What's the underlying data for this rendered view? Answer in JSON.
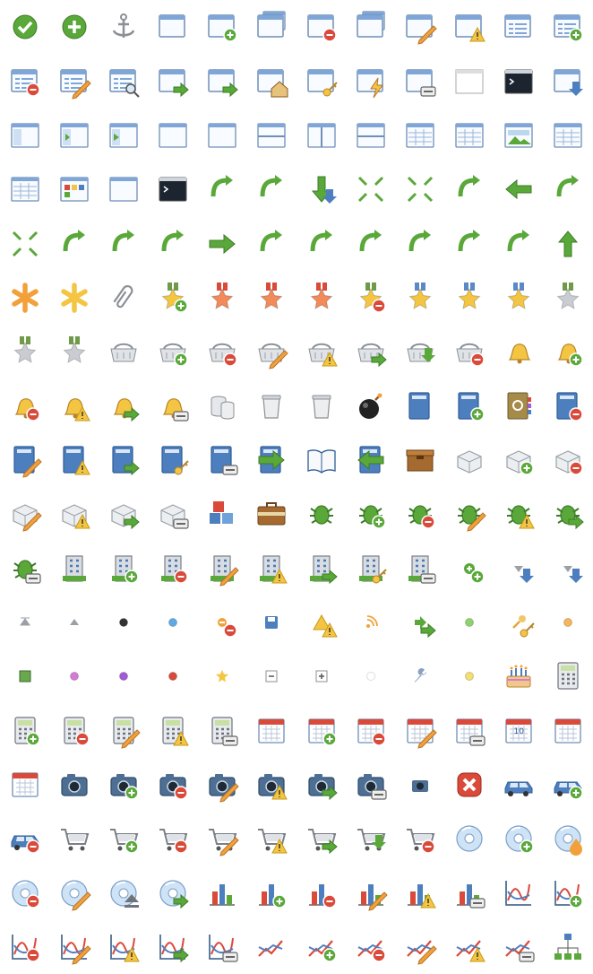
{
  "colors": {
    "green": "#5aa83a",
    "green_dark": "#3c7d26",
    "blue": "#4d7fbf",
    "blue_dark": "#2f5c96",
    "orange": "#f2a13a",
    "red": "#d94a3a",
    "yellow": "#f4c542",
    "gray": "#b8bcc2",
    "gray_dark": "#6f747b",
    "brown": "#a46a2f",
    "purple": "#a25ad6",
    "pink": "#d67ad6"
  },
  "sheet": {
    "columns": 12,
    "rows": [
      [
        "check-circle-icon",
        "add-circle-icon",
        "anchor-icon",
        "window-icon",
        "window-add-icon",
        "windows-cascade-icon",
        "window-delete-icon",
        "windows-icon",
        "window-edit-icon",
        "window-error-icon",
        "window-list-icon",
        "window-list-add-icon"
      ],
      [
        "window-list-delete-icon",
        "window-list-edit-icon",
        "window-list-search-icon",
        "window-go-icon",
        "window-forward-icon",
        "window-home-icon",
        "window-key-icon",
        "window-lightning-icon",
        "window-link-icon",
        "window-blank-icon",
        "console-window-icon",
        "window-down-icon"
      ],
      [
        "layout-sidebar-icon",
        "layout-arrow-left-icon",
        "layout-arrow-right-icon",
        "layout-content-icon",
        "layout-header-icon",
        "layout-split-horizontal-icon",
        "layout-split-vertical-icon",
        "layout-split-rows-icon",
        "layout-table-icon",
        "layout-table-wide-icon",
        "picture-window-icon",
        "layout-grid-icon"
      ],
      [
        "application-list-icon",
        "application-tiles-icon",
        "application-blank-icon",
        "terminal-icon",
        "arrow-branch-icon",
        "arrow-merge-icon",
        "arrow-down-icon",
        "arrows-in-icon",
        "arrows-grid-icon",
        "arrow-join-icon",
        "arrow-left-icon",
        "arrow-turn-up-icon"
      ],
      [
        "arrows-out-icon",
        "arrow-undo-icon",
        "arrow-refresh-icon",
        "arrow-switch-icon",
        "arrow-right-icon",
        "arrow-rotate-ccw-icon",
        "arrow-rotate-cw-icon",
        "arrow-shuffle-icon",
        "arrow-turn-left-icon",
        "arrow-turn-right-icon",
        "arrow-return-icon",
        "arrow-up-icon"
      ],
      [
        "asterisk-orange-icon",
        "asterisk-yellow-icon",
        "paperclip-icon",
        "award-star-add-icon",
        "award-star-bronze-icon",
        "award-star-bronze-2-icon",
        "award-star-bronze-3-icon",
        "award-star-delete-icon",
        "award-star-gold-icon",
        "award-star-gold-2-icon",
        "award-star-gold-3-icon",
        "award-star-silver-icon"
      ],
      [
        "award-star-silver-2-icon",
        "award-star-silver-3-icon",
        "basket-icon",
        "basket-add-icon",
        "basket-delete-icon",
        "basket-edit-icon",
        "basket-error-icon",
        "basket-go-icon",
        "basket-put-icon",
        "basket-remove-icon",
        "bell-icon",
        "bell-add-icon"
      ],
      [
        "bell-delete-icon",
        "bell-error-icon",
        "bell-go-icon",
        "bell-link-icon",
        "database-gray-icon",
        "bin-icon",
        "bin-closed-icon",
        "bomb-icon",
        "book-icon",
        "book-add-icon",
        "book-addresses-icon",
        "book-delete-icon"
      ],
      [
        "book-edit-icon",
        "book-error-icon",
        "book-go-icon",
        "book-key-icon",
        "book-link-icon",
        "book-next-icon",
        "book-open-icon",
        "book-previous-icon",
        "box-icon",
        "brick-icon",
        "brick-add-icon",
        "brick-delete-icon"
      ],
      [
        "brick-edit-icon",
        "brick-error-icon",
        "brick-go-icon",
        "brick-link-icon",
        "bricks-icon",
        "briefcase-icon",
        "bug-icon",
        "bug-add-icon",
        "bug-delete-icon",
        "bug-edit-icon",
        "bug-error-icon",
        "bug-go-icon"
      ],
      [
        "bug-link-icon",
        "building-icon",
        "building-add-icon",
        "building-delete-icon",
        "building-edit-icon",
        "building-error-icon",
        "building-go-icon",
        "building-key-icon",
        "building-link-icon",
        "bullet-add-icon",
        "bullet-arrow-down-icon",
        "bullet-arrow-down-small-icon"
      ],
      [
        "bullet-arrow-top-icon",
        "bullet-arrow-up-icon",
        "bullet-black-icon",
        "bullet-blue-icon",
        "bullet-delete-icon",
        "bullet-disk-icon",
        "bullet-error-icon",
        "bullet-feed-icon",
        "bullet-go-icon",
        "bullet-green-icon",
        "bullet-key-icon",
        "bullet-orange-icon"
      ],
      [
        "bullet-picture-icon",
        "bullet-pink-icon",
        "bullet-purple-icon",
        "bullet-red-icon",
        "bullet-star-icon",
        "bullet-toggle-minus-icon",
        "bullet-toggle-plus-icon",
        "bullet-white-icon",
        "bullet-wrench-icon",
        "bullet-yellow-icon",
        "cake-icon",
        "calculator-icon"
      ],
      [
        "calculator-add-icon",
        "calculator-delete-icon",
        "calculator-edit-icon",
        "calculator-error-icon",
        "calculator-link-icon",
        "calendar-icon",
        "calendar-add-icon",
        "calendar-delete-icon",
        "calendar-edit-icon",
        "calendar-link-icon",
        "calendar-view-day-icon",
        "calendar-view-month-icon"
      ],
      [
        "calendar-view-week-icon",
        "camera-icon",
        "camera-add-icon",
        "camera-delete-icon",
        "camera-edit-icon",
        "camera-error-icon",
        "camera-go-icon",
        "camera-link-icon",
        "camera-small-icon",
        "cancel-icon",
        "car-icon",
        "car-add-icon"
      ],
      [
        "car-delete-icon",
        "cart-icon",
        "cart-add-icon",
        "cart-delete-icon",
        "cart-edit-icon",
        "cart-error-icon",
        "cart-go-icon",
        "cart-put-icon",
        "cart-remove-icon",
        "cd-icon",
        "cd-add-icon",
        "cd-burn-icon"
      ],
      [
        "cd-delete-icon",
        "cd-edit-icon",
        "cd-eject-icon",
        "cd-go-icon",
        "chart-bar-icon",
        "chart-bar-add-icon",
        "chart-bar-delete-icon",
        "chart-bar-edit-icon",
        "chart-bar-error-icon",
        "chart-bar-link-icon",
        "chart-curve-icon",
        "chart-curve-add-icon"
      ],
      [
        "chart-curve-delete-icon",
        "chart-curve-edit-icon",
        "chart-curve-error-icon",
        "chart-curve-go-icon",
        "chart-curve-link-icon",
        "chart-line-icon",
        "chart-line-add-icon",
        "chart-line-delete-icon",
        "chart-line-edit-icon",
        "chart-line-error-icon",
        "chart-line-link-icon",
        "chart-organisation-icon"
      ]
    ]
  },
  "texts": {
    "calendar_day": "10"
  }
}
